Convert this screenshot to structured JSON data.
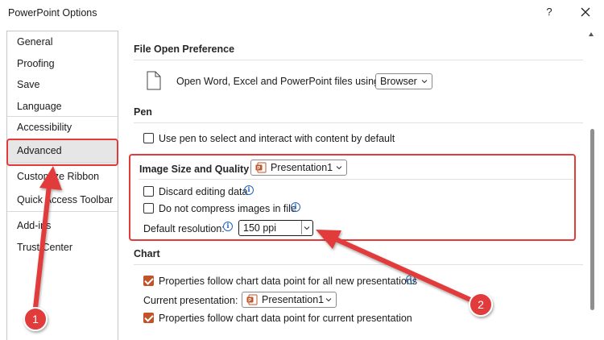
{
  "window": {
    "title": "PowerPoint Options",
    "help_label": "?"
  },
  "sidebar": {
    "items": [
      {
        "label": "General"
      },
      {
        "label": "Proofing"
      },
      {
        "label": "Save"
      },
      {
        "label": "Language"
      },
      {
        "label": "Accessibility"
      },
      {
        "label": "Advanced",
        "selected": true
      },
      {
        "label": "Customize Ribbon"
      },
      {
        "label": "Quick Access Toolbar"
      },
      {
        "label": "Add-ins"
      },
      {
        "label": "Trust Center"
      }
    ]
  },
  "file_open": {
    "header": "File Open Preference",
    "label": "Open Word, Excel and PowerPoint files using:",
    "value": "Browser"
  },
  "pen": {
    "header": "Pen",
    "use_pen_label": "Use pen to select and interact with content by default",
    "use_pen_checked": false
  },
  "image_quality": {
    "header": "Image Size and Quality",
    "presentation": "Presentation1",
    "discard_label": "Discard editing data",
    "discard_checked": false,
    "compress_label": "Do not compress images in file",
    "compress_checked": false,
    "resolution_label": "Default resolution:",
    "resolution_value": "150 ppi"
  },
  "chart": {
    "header": "Chart",
    "follow_all_label": "Properties follow chart data point for all new presentations",
    "follow_all_checked": true,
    "current_label": "Current presentation:",
    "current_value": "Presentation1",
    "follow_current_label": "Properties follow chart data point for current presentation",
    "follow_current_checked": true
  },
  "annotations": {
    "badge1": "1",
    "badge2": "2",
    "accent_color": "#e23b3b"
  },
  "colors": {
    "checkbox_checked": "#c05328",
    "info_icon": "#2266bb",
    "selected_item_bg": "#e6e6e6"
  }
}
